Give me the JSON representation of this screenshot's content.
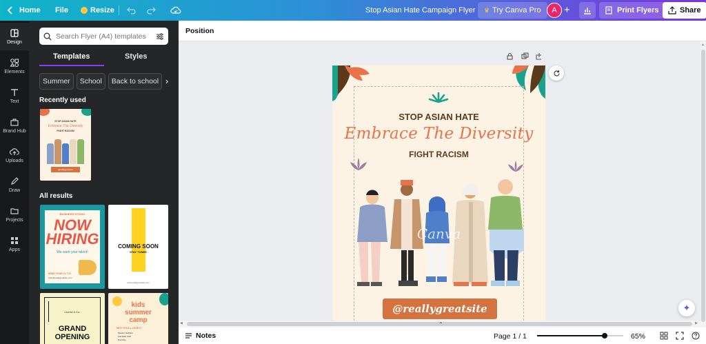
{
  "topbar": {
    "home_label": "Home",
    "file_label": "File",
    "resize_label": "Resize",
    "doc_title": "Stop Asian Hate Campaign Flyer",
    "try_pro_label": "Try Canva Pro",
    "avatar_initial": "A",
    "print_label": "Print Flyers",
    "share_label": "Share"
  },
  "rail": {
    "items": [
      {
        "label": "Design",
        "icon": "design-icon"
      },
      {
        "label": "Elements",
        "icon": "elements-icon"
      },
      {
        "label": "Text",
        "icon": "text-icon"
      },
      {
        "label": "Brand Hub",
        "icon": "brand-hub-icon"
      },
      {
        "label": "Uploads",
        "icon": "uploads-icon"
      },
      {
        "label": "Draw",
        "icon": "draw-icon"
      },
      {
        "label": "Projects",
        "icon": "projects-icon"
      },
      {
        "label": "Apps",
        "icon": "apps-icon"
      }
    ]
  },
  "panel": {
    "search_placeholder": "Search Flyer (A4) templates",
    "tabs": [
      "Templates",
      "Styles"
    ],
    "chips": [
      "Summer",
      "School",
      "Back to school"
    ],
    "recent_title": "Recently used",
    "all_title": "All results",
    "recent_thumb": {
      "line1": "STOP ASIAN HATE",
      "line2": "Embrace The Diversity",
      "line3": "FIGHT RACISM",
      "line4": "@reallygreatsite"
    },
    "results": [
      {
        "top": "BUSINESS STUDIO",
        "title1": "NOW",
        "title2": "HIRING",
        "sub": "We want your talent!",
        "foot": "SEND YOUR CV TO:",
        "foot2": "hello@reallygreatsite.com"
      },
      {
        "title1": "COMING SOON",
        "title2": "STAY TUNED",
        "foot": "www.reallygreatsite.com"
      },
      {
        "top": "Liceria & Co.",
        "title1": "GRAND",
        "title2": "OPENING"
      },
      {
        "title1": "kids",
        "title2": "summer",
        "title3": "camp",
        "sub": "WHY YOU'LL LOVE IT",
        "items": [
          "Modern facilities",
          "Fantastic staff",
          "Diversity"
        ]
      }
    ]
  },
  "toolbar": {
    "position_label": "Position"
  },
  "flyer": {
    "headline": "STOP ASIAN HATE",
    "script": "Embrace The Diversity",
    "subhead": "FIGHT RACISM",
    "watermark": "Canva",
    "site": "@reallygreatsite"
  },
  "bottombar": {
    "notes_label": "Notes",
    "page_label": "Page 1 / 1",
    "zoom_label": "65%",
    "zoom_value": 0.65
  },
  "colors": {
    "orange": "#e8734a",
    "teal": "#1aa38c",
    "brown": "#5b3a1c",
    "cream": "#fdf3e4",
    "purple": "#8b3dff"
  }
}
